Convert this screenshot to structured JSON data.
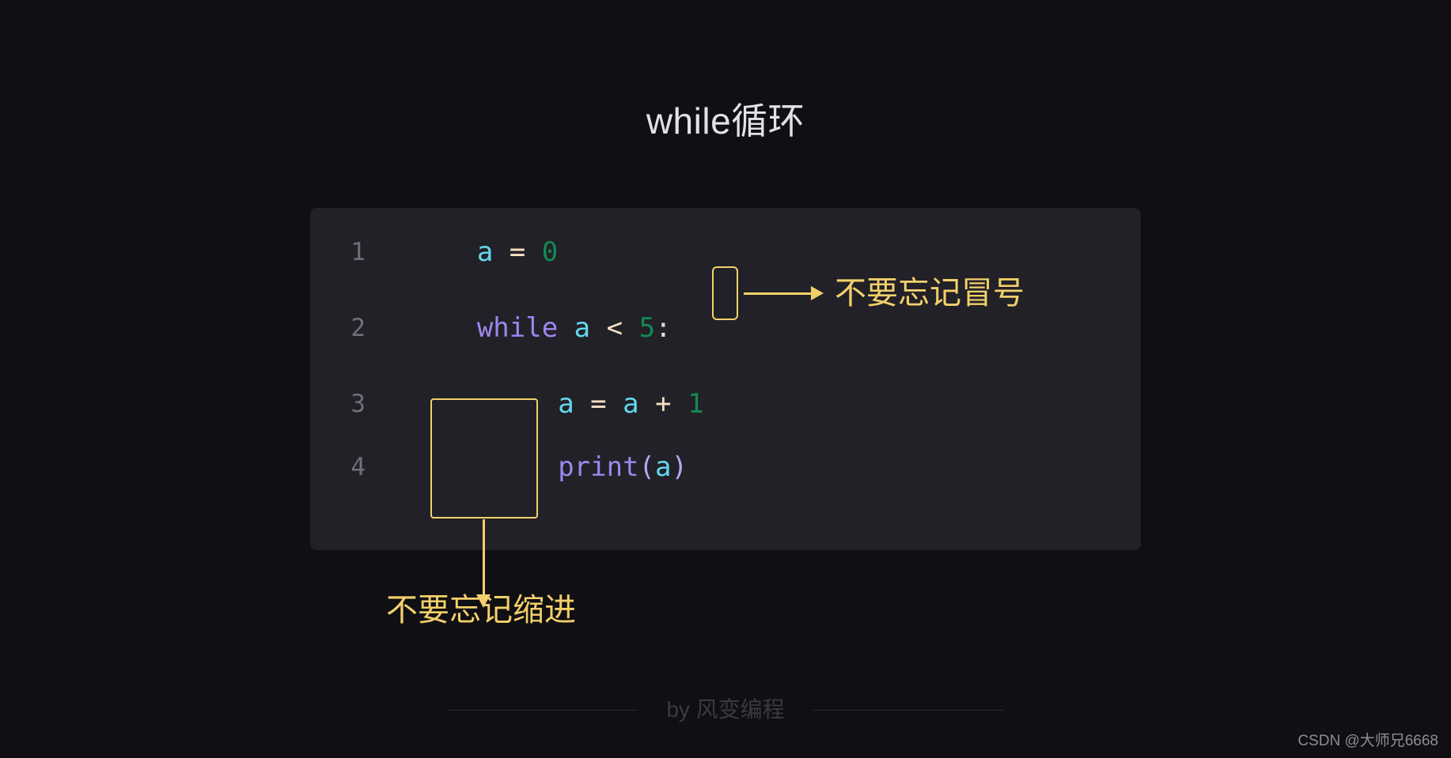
{
  "slide": {
    "title": "while循环",
    "background_color": "#100f13"
  },
  "code_block": {
    "background_color": "#222127",
    "language": "python",
    "lines": [
      {
        "number": "1",
        "text": "a = 0",
        "tokens": [
          {
            "t": "a",
            "kind": "var"
          },
          {
            "t": " ",
            "kind": "plain"
          },
          {
            "t": "=",
            "kind": "op"
          },
          {
            "t": " ",
            "kind": "plain"
          },
          {
            "t": "0",
            "kind": "num"
          }
        ]
      },
      {
        "number": "2",
        "text": "while a < 5:",
        "tokens": [
          {
            "t": "while",
            "kind": "kw"
          },
          {
            "t": " ",
            "kind": "plain"
          },
          {
            "t": "a",
            "kind": "var"
          },
          {
            "t": " ",
            "kind": "plain"
          },
          {
            "t": "<",
            "kind": "op"
          },
          {
            "t": " ",
            "kind": "plain"
          },
          {
            "t": "5",
            "kind": "num"
          },
          {
            "t": ":",
            "kind": "colon"
          }
        ]
      },
      {
        "number": "3",
        "text": "    a = a + 1",
        "tokens": [
          {
            "t": "    ",
            "kind": "plain"
          },
          {
            "t": "a",
            "kind": "var"
          },
          {
            "t": " ",
            "kind": "plain"
          },
          {
            "t": "=",
            "kind": "op"
          },
          {
            "t": " ",
            "kind": "plain"
          },
          {
            "t": "a",
            "kind": "var"
          },
          {
            "t": " ",
            "kind": "plain"
          },
          {
            "t": "+",
            "kind": "op"
          },
          {
            "t": " ",
            "kind": "plain"
          },
          {
            "t": "1",
            "kind": "num"
          }
        ]
      },
      {
        "number": "4",
        "text": "    print(a)",
        "tokens": [
          {
            "t": "    ",
            "kind": "plain"
          },
          {
            "t": "print",
            "kind": "fn"
          },
          {
            "t": "(",
            "kind": "paren"
          },
          {
            "t": "a",
            "kind": "var"
          },
          {
            "t": ")",
            "kind": "paren"
          }
        ]
      }
    ],
    "line1_rendered": "a = 0",
    "line2_rendered": "while a < 5",
    "line2_colon": ":",
    "line3_rendered": "a = a + 1",
    "line4_rendered": "print(a)"
  },
  "annotations": {
    "color": "#f3d06b",
    "colon": {
      "label": "不要忘记冒号",
      "highlights": "colon-character"
    },
    "indent": {
      "label": "不要忘记缩进",
      "highlights": "indentation-whitespace"
    }
  },
  "footer": {
    "credit": "by 风变编程"
  },
  "watermark": {
    "text": "CSDN @大师兄6668"
  }
}
